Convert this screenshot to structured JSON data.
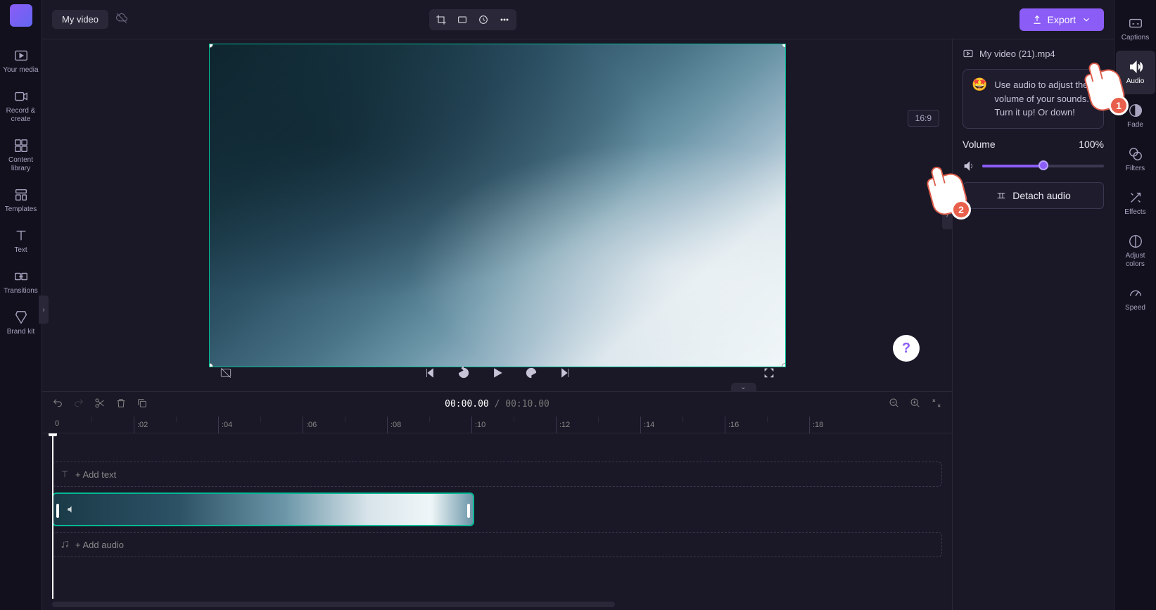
{
  "top": {
    "title": "My video",
    "export_label": "Export",
    "aspect": "16:9"
  },
  "left_rail": {
    "media": "Your media",
    "record": "Record & create",
    "content": "Content library",
    "templates": "Templates",
    "text": "Text",
    "transitions": "Transitions",
    "brand": "Brand kit"
  },
  "right_rail": {
    "captions": "Captions",
    "audio": "Audio",
    "fade": "Fade",
    "filters": "Filters",
    "effects": "Effects",
    "adjust": "Adjust colors",
    "speed": "Speed"
  },
  "panel": {
    "file_name": "My video (21).mp4",
    "tip_text": "Use audio to adjust the volume of your sounds. Turn it up! Or down!",
    "volume_label": "Volume",
    "volume_value": "100%",
    "detach_label": "Detach audio"
  },
  "timeline": {
    "current": "00:00.00",
    "sep": " / ",
    "total": "00:10.00",
    "add_text": "+ Add text",
    "add_audio": "+ Add audio",
    "marker_0": "0",
    "ticks": [
      ":02",
      ":04",
      ":06",
      ":08",
      ":10",
      ":12",
      ":14",
      ":16",
      ":18"
    ]
  },
  "callouts": {
    "c1": "1",
    "c2": "2"
  }
}
